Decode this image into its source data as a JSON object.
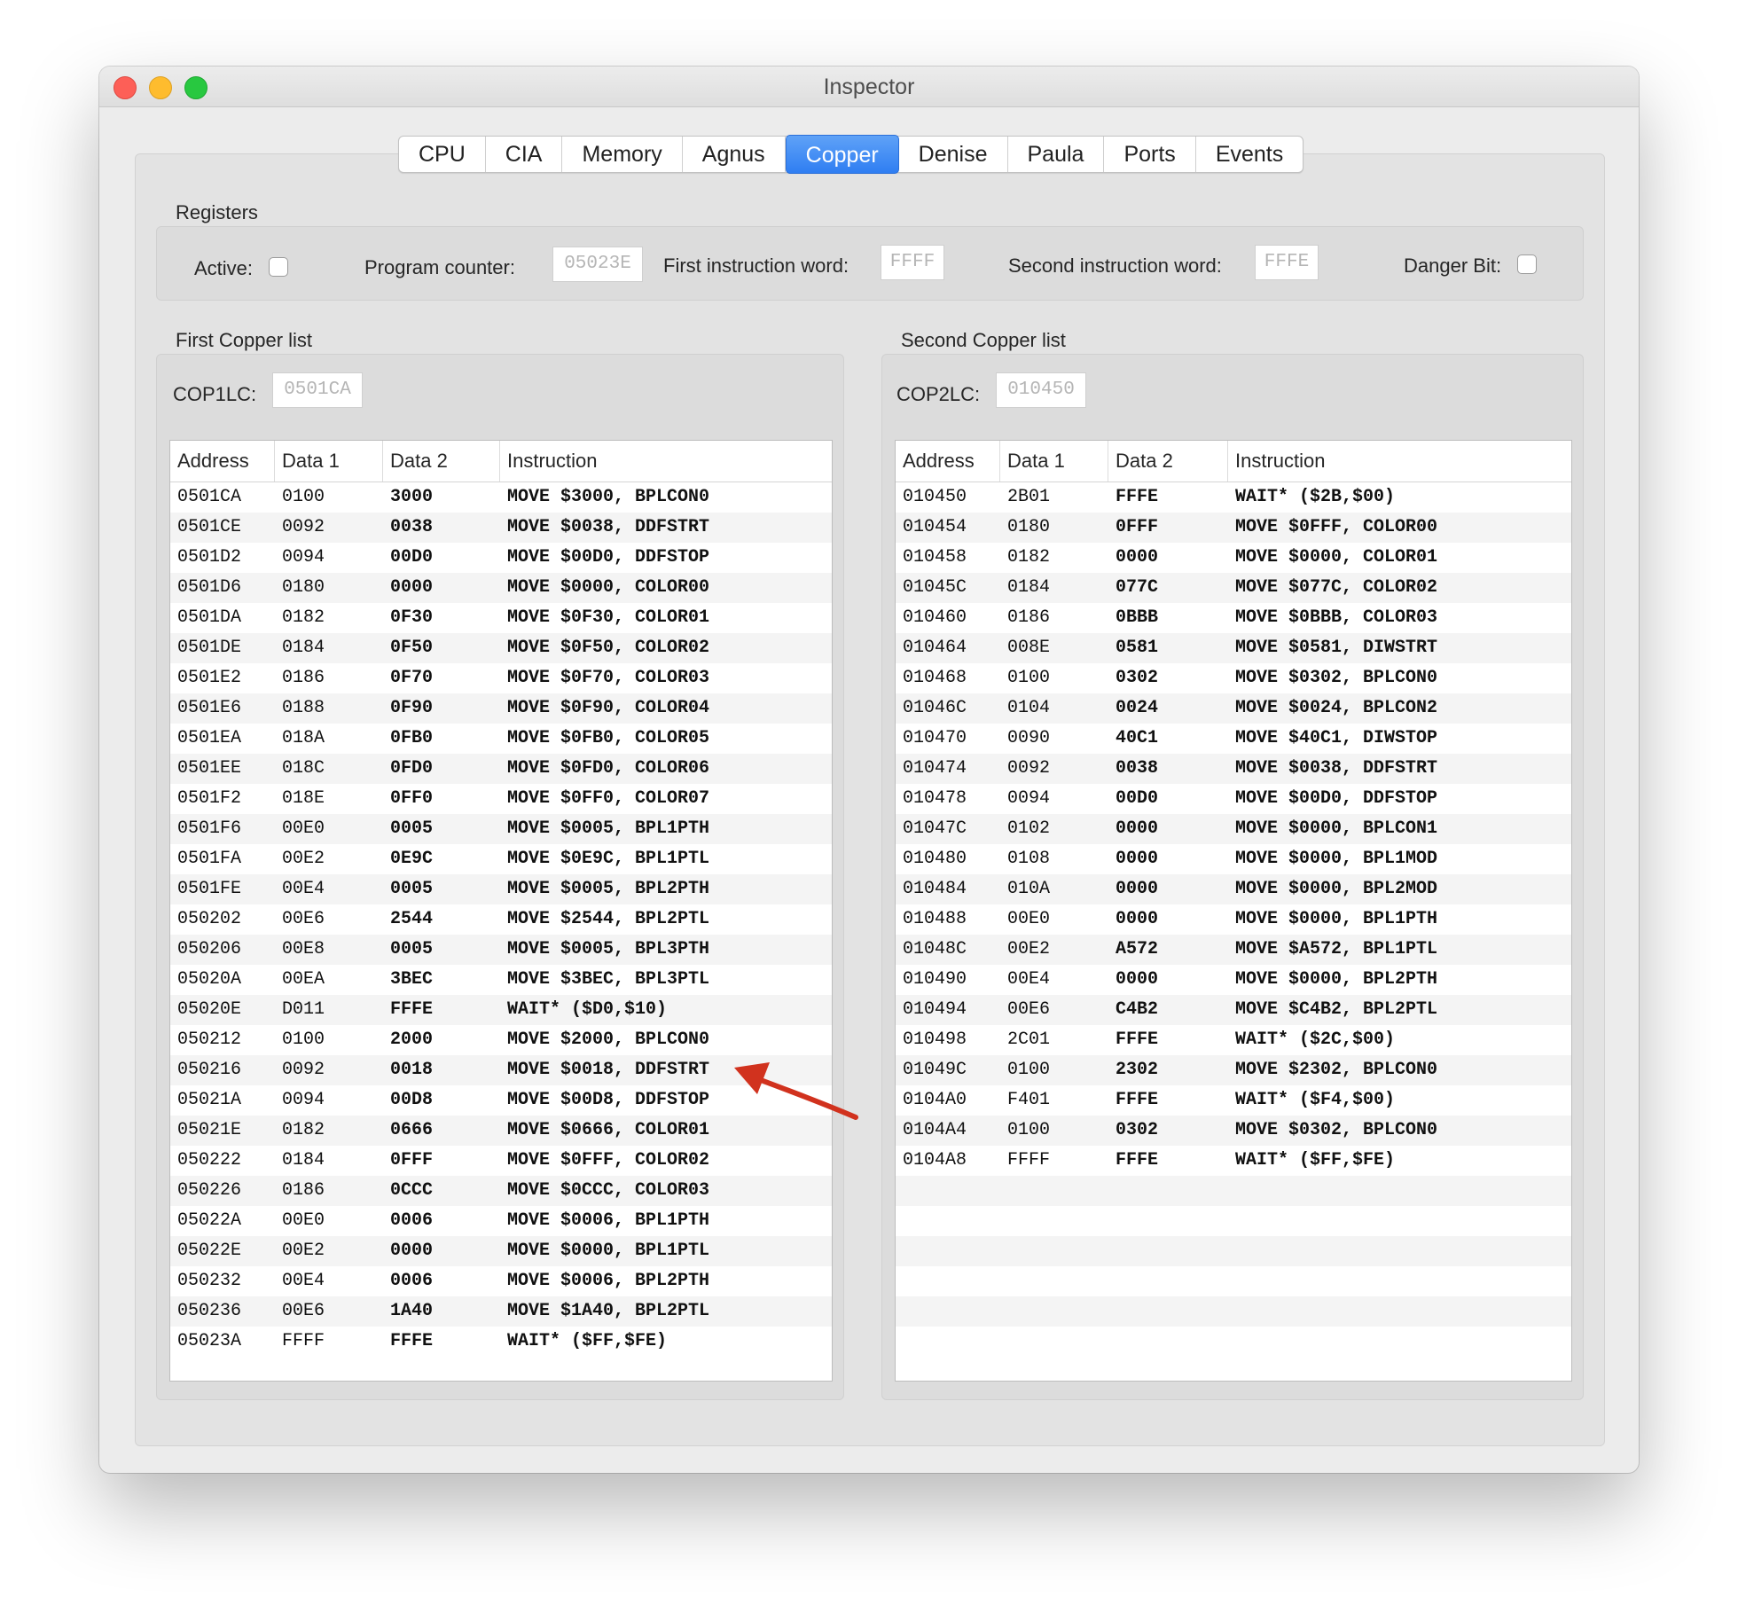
{
  "window": {
    "title": "Inspector"
  },
  "tabs": [
    "CPU",
    "CIA",
    "Memory",
    "Agnus",
    "Copper",
    "Denise",
    "Paula",
    "Ports",
    "Events"
  ],
  "active_tab": "Copper",
  "registers": {
    "section_label": "Registers",
    "active_label": "Active:",
    "active_checked": false,
    "pc_label": "Program counter:",
    "pc_value": "05023E",
    "first_word_label": "First instruction word:",
    "first_word_value": "FFFF",
    "second_word_label": "Second instruction word:",
    "second_word_value": "FFFE",
    "danger_label": "Danger Bit:",
    "danger_checked": false
  },
  "list1": {
    "section_label": "First Copper list",
    "lc_label": "COP1LC:",
    "lc_value": "0501CA",
    "columns": [
      "Address",
      "Data 1",
      "Data 2",
      "Instruction"
    ],
    "rows": [
      [
        "0501CA",
        "0100",
        "3000",
        "MOVE $3000, BPLCON0"
      ],
      [
        "0501CE",
        "0092",
        "0038",
        "MOVE $0038, DDFSTRT"
      ],
      [
        "0501D2",
        "0094",
        "00D0",
        "MOVE $00D0, DDFSTOP"
      ],
      [
        "0501D6",
        "0180",
        "0000",
        "MOVE $0000, COLOR00"
      ],
      [
        "0501DA",
        "0182",
        "0F30",
        "MOVE $0F30, COLOR01"
      ],
      [
        "0501DE",
        "0184",
        "0F50",
        "MOVE $0F50, COLOR02"
      ],
      [
        "0501E2",
        "0186",
        "0F70",
        "MOVE $0F70, COLOR03"
      ],
      [
        "0501E6",
        "0188",
        "0F90",
        "MOVE $0F90, COLOR04"
      ],
      [
        "0501EA",
        "018A",
        "0FB0",
        "MOVE $0FB0, COLOR05"
      ],
      [
        "0501EE",
        "018C",
        "0FD0",
        "MOVE $0FD0, COLOR06"
      ],
      [
        "0501F2",
        "018E",
        "0FF0",
        "MOVE $0FF0, COLOR07"
      ],
      [
        "0501F6",
        "00E0",
        "0005",
        "MOVE $0005, BPL1PTH"
      ],
      [
        "0501FA",
        "00E2",
        "0E9C",
        "MOVE $0E9C, BPL1PTL"
      ],
      [
        "0501FE",
        "00E4",
        "0005",
        "MOVE $0005, BPL2PTH"
      ],
      [
        "050202",
        "00E6",
        "2544",
        "MOVE $2544, BPL2PTL"
      ],
      [
        "050206",
        "00E8",
        "0005",
        "MOVE $0005, BPL3PTH"
      ],
      [
        "05020A",
        "00EA",
        "3BEC",
        "MOVE $3BEC, BPL3PTL"
      ],
      [
        "05020E",
        "D011",
        "FFFE",
        "WAIT* ($D0,$10)"
      ],
      [
        "050212",
        "0100",
        "2000",
        "MOVE $2000, BPLCON0"
      ],
      [
        "050216",
        "0092",
        "0018",
        "MOVE $0018, DDFSTRT"
      ],
      [
        "05021A",
        "0094",
        "00D8",
        "MOVE $00D8, DDFSTOP"
      ],
      [
        "05021E",
        "0182",
        "0666",
        "MOVE $0666, COLOR01"
      ],
      [
        "050222",
        "0184",
        "0FFF",
        "MOVE $0FFF, COLOR02"
      ],
      [
        "050226",
        "0186",
        "0CCC",
        "MOVE $0CCC, COLOR03"
      ],
      [
        "05022A",
        "00E0",
        "0006",
        "MOVE $0006, BPL1PTH"
      ],
      [
        "05022E",
        "00E2",
        "0000",
        "MOVE $0000, BPL1PTL"
      ],
      [
        "050232",
        "00E4",
        "0006",
        "MOVE $0006, BPL2PTH"
      ],
      [
        "050236",
        "00E6",
        "1A40",
        "MOVE $1A40, BPL2PTL"
      ],
      [
        "05023A",
        "FFFF",
        "FFFE",
        "WAIT* ($FF,$FE)"
      ]
    ]
  },
  "list2": {
    "section_label": "Second Copper list",
    "lc_label": "COP2LC:",
    "lc_value": "010450",
    "columns": [
      "Address",
      "Data 1",
      "Data 2",
      "Instruction"
    ],
    "rows": [
      [
        "010450",
        "2B01",
        "FFFE",
        "WAIT* ($2B,$00)"
      ],
      [
        "010454",
        "0180",
        "0FFF",
        "MOVE $0FFF, COLOR00"
      ],
      [
        "010458",
        "0182",
        "0000",
        "MOVE $0000, COLOR01"
      ],
      [
        "01045C",
        "0184",
        "077C",
        "MOVE $077C, COLOR02"
      ],
      [
        "010460",
        "0186",
        "0BBB",
        "MOVE $0BBB, COLOR03"
      ],
      [
        "010464",
        "008E",
        "0581",
        "MOVE $0581, DIWSTRT"
      ],
      [
        "010468",
        "0100",
        "0302",
        "MOVE $0302, BPLCON0"
      ],
      [
        "01046C",
        "0104",
        "0024",
        "MOVE $0024, BPLCON2"
      ],
      [
        "010470",
        "0090",
        "40C1",
        "MOVE $40C1, DIWSTOP"
      ],
      [
        "010474",
        "0092",
        "0038",
        "MOVE $0038, DDFSTRT"
      ],
      [
        "010478",
        "0094",
        "00D0",
        "MOVE $00D0, DDFSTOP"
      ],
      [
        "01047C",
        "0102",
        "0000",
        "MOVE $0000, BPLCON1"
      ],
      [
        "010480",
        "0108",
        "0000",
        "MOVE $0000, BPL1MOD"
      ],
      [
        "010484",
        "010A",
        "0000",
        "MOVE $0000, BPL2MOD"
      ],
      [
        "010488",
        "00E0",
        "0000",
        "MOVE $0000, BPL1PTH"
      ],
      [
        "01048C",
        "00E2",
        "A572",
        "MOVE $A572, BPL1PTL"
      ],
      [
        "010490",
        "00E4",
        "0000",
        "MOVE $0000, BPL2PTH"
      ],
      [
        "010494",
        "00E6",
        "C4B2",
        "MOVE $C4B2, BPL2PTL"
      ],
      [
        "010498",
        "2C01",
        "FFFE",
        "WAIT* ($2C,$00)"
      ],
      [
        "01049C",
        "0100",
        "2302",
        "MOVE $2302, BPLCON0"
      ],
      [
        "0104A0",
        "F401",
        "FFFE",
        "WAIT* ($F4,$00)"
      ],
      [
        "0104A4",
        "0100",
        "0302",
        "MOVE $0302, BPLCON0"
      ],
      [
        "0104A8",
        "FFFF",
        "FFFE",
        "WAIT* ($FF,$FE)"
      ]
    ]
  }
}
